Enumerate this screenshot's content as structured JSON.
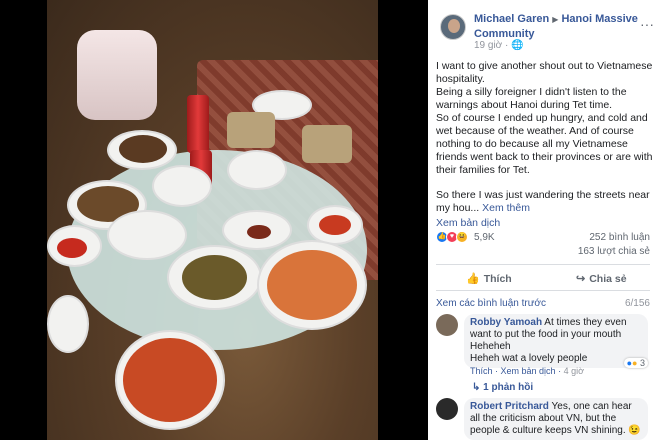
{
  "post": {
    "author": "Michael Garen",
    "separator": "▶",
    "group": "Hanoi Massive Community",
    "time": "19 giờ",
    "privacy_icon": "globe-icon",
    "more_icon": "more-icon",
    "paragraphs": [
      "I want to give another shout out to Vietnamese hospitality.",
      "Being a silly foreigner I didn't listen to the warnings about Hanoi during Tet time.",
      "So of course I ended up hungry, and cold and wet because of the weather. And of course nothing to do because all my Vietnamese friends went back to their provinces or are with their families for Tet.",
      "So there I was just wandering the streets near my hou..."
    ],
    "see_more": "Xem thêm",
    "see_translation": "Xem bản dịch"
  },
  "stats": {
    "reaction_count": "5,9K",
    "comments": "252 bình luận",
    "shares": "163 lượt chia sẻ"
  },
  "actions": {
    "like": "Thích",
    "share": "Chia sẻ"
  },
  "comments_header": {
    "view_previous": "Xem các bình luận trước",
    "count": "6/156"
  },
  "comments": [
    {
      "name": "Robby Yamoah",
      "text_line1": "At times they even want to put the food in your mouth",
      "text_line2": "Heheheh",
      "text_line3": "Heheh wat a lovely people",
      "like": "Thích",
      "translate": "Xem bản dịch",
      "time": "4 giờ",
      "reactions": "3",
      "replies": "1 phản hồi"
    },
    {
      "name": "Robert Pritchard",
      "text": "Yes, one can hear all the criticism about VN, but the people & culture keeps VN shining. 😉"
    }
  ],
  "colors": {
    "link": "#385898",
    "like_blue": "#1877f2",
    "love_red": "#f33e58",
    "haha_yellow": "#f7b125"
  }
}
